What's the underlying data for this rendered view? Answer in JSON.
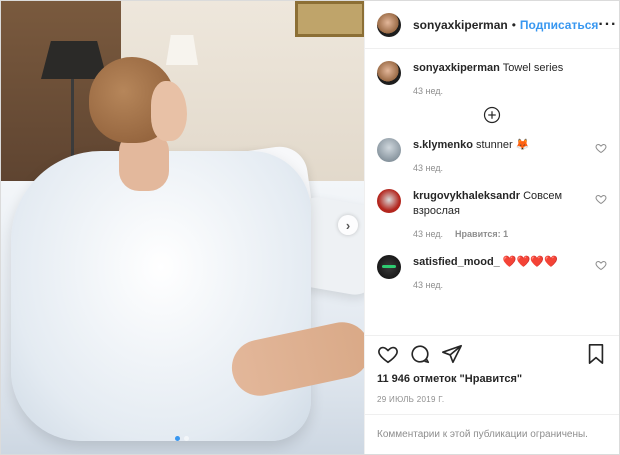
{
  "header": {
    "username": "sonyaxkiperman",
    "separator": "•",
    "follow_label": "Подписаться",
    "more_label": "···"
  },
  "caption": {
    "username": "sonyaxkiperman",
    "text": "Towel series",
    "time": "43 нед."
  },
  "comments": [
    {
      "username": "s.klymenko",
      "text": "stunner 🦊",
      "time": "43 нед.",
      "reply": ""
    },
    {
      "username": "krugovykhaleksandr",
      "text": "Совсем взрослая",
      "time": "43 нед.",
      "reply": "Нравится: 1"
    },
    {
      "username": "satisfied_mood_",
      "text": "❤️❤️❤️❤️",
      "time": "43 нед.",
      "reply": ""
    }
  ],
  "likes_text": "11 946 отметок \"Нравится\"",
  "date_text": "29 ИЮЛЬ 2019 Г.",
  "comments_restricted": "Комментарии к этой публикации ограничены.",
  "carousel": {
    "slides": 2,
    "active": 1
  },
  "colors": {
    "accent": "#3897f0",
    "text": "#262626",
    "muted": "#8e8e8e",
    "border": "#efefef"
  },
  "icons": {
    "like": "heart-icon",
    "comment": "comment-icon",
    "share": "share-icon",
    "save": "bookmark-icon",
    "load_more": "plus-circle-icon",
    "next": "chevron-right-icon"
  }
}
